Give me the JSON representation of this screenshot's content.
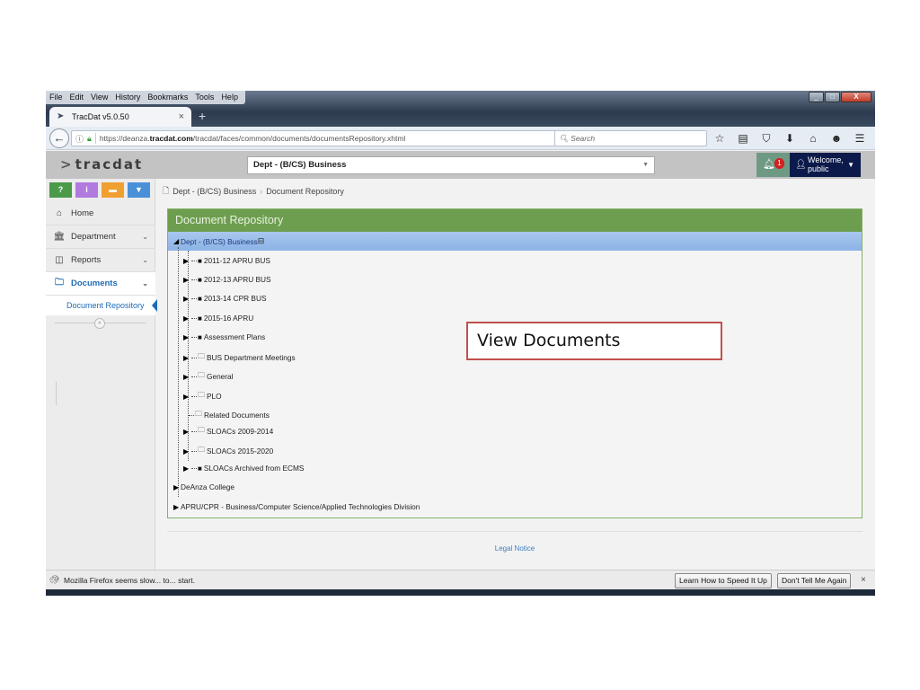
{
  "browser": {
    "menu": [
      "File",
      "Edit",
      "View",
      "History",
      "Bookmarks",
      "Tools",
      "Help"
    ],
    "tab_title": "TracDat v5.0.50",
    "url_prefix": "https://deanza.",
    "url_domain": "tracdat.com",
    "url_path": "/tracdat/faces/common/documents/documentsRepository.xhtml",
    "search_placeholder": "Search"
  },
  "app": {
    "logo": "tracdat",
    "dept_select": "Dept - (B/CS) Business",
    "notification_count": "1",
    "welcome_line1": "Welcome,",
    "welcome_line2": "public"
  },
  "toolbar_buttons": [
    {
      "label": "?",
      "color": "#4a9a4a"
    },
    {
      "label": "i",
      "color": "#b07adf"
    },
    {
      "label": "▬",
      "color": "#f0a030"
    },
    {
      "label": "▼",
      "color": "#4a90d9"
    }
  ],
  "sidebar": {
    "items": [
      {
        "label": "Home",
        "icon": "home-icon"
      },
      {
        "label": "Department",
        "icon": "bank-icon"
      },
      {
        "label": "Reports",
        "icon": "columns-icon"
      },
      {
        "label": "Documents",
        "icon": "folder-icon"
      }
    ],
    "sub_item": "Document Repository"
  },
  "breadcrumb": [
    "Dept - (B/CS) Business",
    "Document Repository"
  ],
  "panel": {
    "title": "Document Repository",
    "root": "Dept - (B/CS) Business",
    "children": [
      {
        "label": "2011-12 APRU BUS",
        "filled": true,
        "expandable": true
      },
      {
        "label": "2012-13 APRU BUS",
        "filled": true,
        "expandable": true
      },
      {
        "label": "2013-14 CPR BUS",
        "filled": true,
        "expandable": true
      },
      {
        "label": "2015-16 APRU",
        "filled": true,
        "expandable": true
      },
      {
        "label": "Assessment Plans",
        "filled": true,
        "expandable": true
      },
      {
        "label": "BUS Department Meetings",
        "filled": false,
        "expandable": true
      },
      {
        "label": "General",
        "filled": false,
        "expandable": true
      },
      {
        "label": "PLO",
        "filled": false,
        "expandable": true
      },
      {
        "label": "Related Documents",
        "filled": false,
        "expandable": false
      },
      {
        "label": "SLOACs 2009-2014",
        "filled": false,
        "expandable": true
      },
      {
        "label": "SLOACs 2015-2020",
        "filled": false,
        "expandable": true
      },
      {
        "label": "SLOACs Archived from ECMS",
        "filled": true,
        "expandable": true
      }
    ],
    "siblings": [
      "DeAnza College",
      "APRU/CPR - Business/Computer Science/Applied Technologies Division"
    ]
  },
  "footer": {
    "legal": "Legal Notice"
  },
  "notification_bar": {
    "text": "Mozilla Firefox seems slow... to... start.",
    "button1": "Learn How to Speed It Up",
    "button2": "Don't Tell Me Again",
    "close": "×"
  },
  "callout": "View Documents"
}
